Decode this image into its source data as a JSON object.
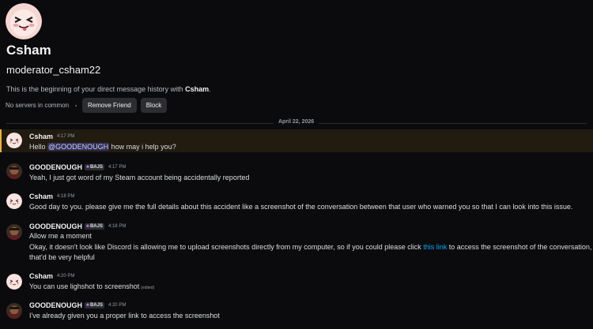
{
  "profile": {
    "display_name": "Csham",
    "username": "moderator_csham22",
    "intro_prefix": "This is the beginning of your direct message history with ",
    "intro_name": "Csham",
    "intro_suffix": ".",
    "no_servers": "No servers in common",
    "remove_friend_label": "Remove Friend",
    "block_label": "Block"
  },
  "date_divider": "April 22, 2026",
  "colors": {
    "accent": "#5865f2",
    "highlight": "#f0b232",
    "link": "#00a8fc",
    "background": "#0b0b0d"
  },
  "messages": [
    {
      "author": "Csham",
      "time": "4:17 PM",
      "pre": "Hello ",
      "mention": "@GOODENOUGH",
      "post": " how may i help you?"
    },
    {
      "author": "GOODENOUGH",
      "tag": "BAJS",
      "tag_icon": "mushroom-icon",
      "time": "4:17 PM",
      "text": "Yeah, I just got word of my Steam account being accidentally reported"
    },
    {
      "author": "Csham",
      "time": "4:18 PM",
      "text": "Good day to you. please give me the full details about this accident like a screenshot of the conversation between that user who warned you so that I can look into this issue."
    },
    {
      "author": "GOODENOUGH",
      "tag": "BAJS",
      "time": "4:18 PM",
      "line1": "Allow me a moment",
      "line2_pre": "Okay, it doesn't look like Discord is allowing me to upload screenshots directly from my computer, so if you could please click ",
      "link": "this link",
      "line2_post": "  to access the screenshot of the conversation,",
      "line3": "that'd be very helpful"
    },
    {
      "author": "Csham",
      "time": "4:20 PM",
      "text": "You can use lighshot to screenshot",
      "edited": "(edited)"
    },
    {
      "author": "GOODENOUGH",
      "tag": "BAJS",
      "time": "4:20 PM",
      "text": "I've already given you a proper link to access the screenshot"
    }
  ]
}
